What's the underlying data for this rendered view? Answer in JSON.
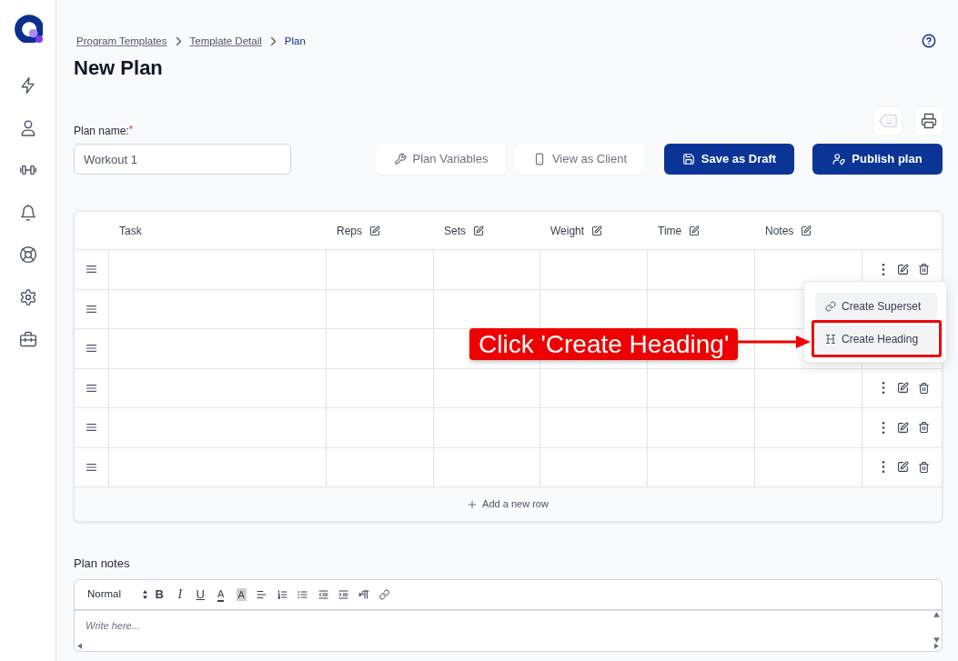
{
  "breadcrumb": [
    {
      "label": "Program Templates",
      "current": false
    },
    {
      "label": "Template Detail",
      "current": false
    },
    {
      "label": "Plan",
      "current": true
    }
  ],
  "page_title": "New Plan",
  "icon_buttons": [
    {
      "kind": "keyboard",
      "disabled": true
    },
    {
      "kind": "print",
      "disabled": false
    }
  ],
  "plan_name": {
    "label": "Plan name:",
    "required_marker": "*",
    "value": "Workout 1"
  },
  "actions": [
    {
      "label": "Plan Variables",
      "kind": "secondary"
    },
    {
      "label": "View as Client",
      "kind": "secondary"
    },
    {
      "label": "Save as Draft",
      "kind": "primary"
    },
    {
      "label": "Publish plan",
      "kind": "primary"
    }
  ],
  "table": {
    "columns": [
      {
        "label": "Task",
        "editable": false
      },
      {
        "label": "Reps",
        "editable": true
      },
      {
        "label": "Sets",
        "editable": true
      },
      {
        "label": "Weight",
        "editable": true
      },
      {
        "label": "Time",
        "editable": true
      },
      {
        "label": "Notes",
        "editable": true
      }
    ],
    "rows": [
      {
        "menu_open": true
      },
      {
        "menu_open": false
      },
      {
        "menu_open": false
      },
      {
        "menu_open": false
      },
      {
        "menu_open": false
      },
      {
        "menu_open": false
      }
    ],
    "row_menu": {
      "items": [
        {
          "label": "Create Superset",
          "highlighted": false
        },
        {
          "label": "Create Heading",
          "highlighted": true
        }
      ]
    },
    "add_row": {
      "label": "Add a new row"
    }
  },
  "callout": {
    "text": "Click 'Create Heading'"
  },
  "plan_notes": {
    "label": "Plan notes",
    "format": "Normal",
    "toolbar": [
      {
        "kind": "bold",
        "label": "B"
      },
      {
        "kind": "italic",
        "label": "I"
      },
      {
        "kind": "underline",
        "label": "U"
      },
      {
        "kind": "color",
        "label": "A"
      },
      {
        "kind": "background",
        "label": "A"
      },
      {
        "kind": "align"
      },
      {
        "kind": "ordered-list"
      },
      {
        "kind": "bullet-list"
      },
      {
        "kind": "outdent"
      },
      {
        "kind": "indent"
      },
      {
        "kind": "direction"
      },
      {
        "kind": "link"
      }
    ],
    "placeholder": "Write here..."
  }
}
